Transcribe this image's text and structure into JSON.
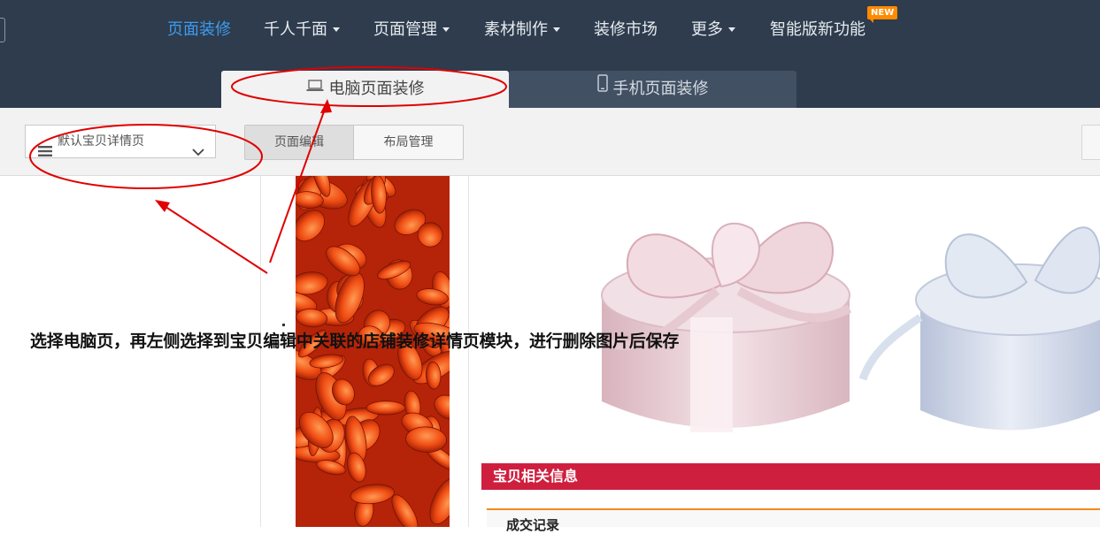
{
  "nav": {
    "items": [
      {
        "label": "页面装修",
        "active": true,
        "dropdown": false
      },
      {
        "label": "千人千面",
        "active": false,
        "dropdown": true
      },
      {
        "label": "页面管理",
        "active": false,
        "dropdown": true
      },
      {
        "label": "素材制作",
        "active": false,
        "dropdown": true
      },
      {
        "label": "装修市场",
        "active": false,
        "dropdown": false
      },
      {
        "label": "更多",
        "active": false,
        "dropdown": true
      },
      {
        "label": "智能版新功能",
        "active": false,
        "dropdown": false
      }
    ],
    "new_badge": "NEW"
  },
  "tabs": {
    "pc": {
      "label": "电脑页面装修",
      "icon": "laptop-icon",
      "active": true
    },
    "mobile": {
      "label": "手机页面装修",
      "icon": "phone-icon",
      "active": false
    }
  },
  "toolbar": {
    "page_select": {
      "value": "默认宝贝详情页",
      "icon": "menu-icon"
    },
    "edit_button": "页面编辑",
    "layout_button": "布局管理"
  },
  "canvas": {
    "info_bar": "宝贝相关信息",
    "record_title": "成交记录"
  },
  "annotation_text": "选择电脑页，再左侧选择到宝贝编辑中关联的店铺装修详情页模块，进行删除图片后保存",
  "colors": {
    "topbar": "#2e3c4d",
    "active_nav": "#3d9cf0",
    "info_bar": "#cf1f3f",
    "annotation_red": "#e00000",
    "badge": "#ff8a00"
  }
}
